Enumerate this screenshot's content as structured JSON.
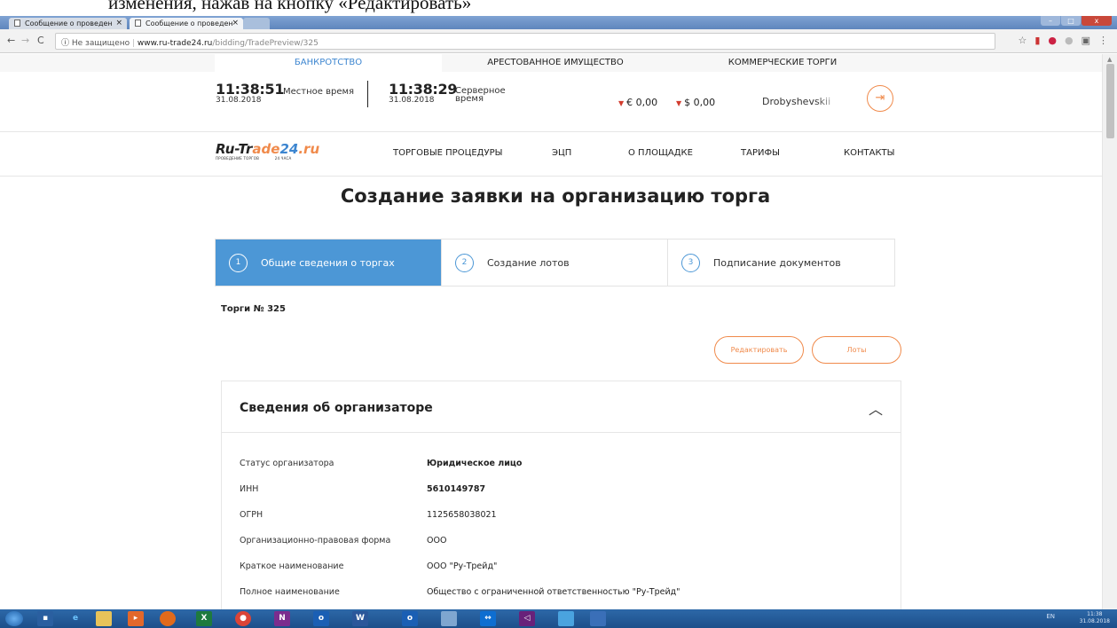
{
  "doc_caption": "изменения, нажав на кнопку «Редактировать»",
  "browser": {
    "tabs": [
      {
        "title": "Сообщение о проведен"
      },
      {
        "title": "Сообщение о проведен"
      }
    ],
    "close_glyph": "×",
    "address": {
      "security": "Не защищено",
      "host": "www.ru-trade24.ru",
      "path": "/bidding/TradePreview/325"
    },
    "nav_icons": [
      "back-icon",
      "forward-icon",
      "reload-icon"
    ],
    "toolbar_icons": [
      "star-icon",
      "extension-icon",
      "profile-icon",
      "circle-icon",
      "cast-icon",
      "menu-icon"
    ]
  },
  "top_nav": {
    "items": [
      "БАНКРОТСТВО",
      "АРЕСТОВАННОЕ ИМУЩЕСТВО",
      "КОММЕРЧЕСКИЕ ТОРГИ"
    ],
    "active_index": 0
  },
  "info": {
    "local": {
      "time": "11:38:51",
      "date": "31.08.2018",
      "label": "Местное время"
    },
    "server": {
      "time": "11:38:29",
      "date": "31.08.2018",
      "label_line1": "Серверное",
      "label_line2": "время"
    },
    "euro": "€ 0,00",
    "dollar": "$ 0,00",
    "user": "Drobyshevskii"
  },
  "logo": {
    "part1": "Ru-Tr",
    "part2": "ade",
    "part3": "24",
    "part4": ".ru",
    "sub_left": "ПРОВЕДЕНИЕ ТОРГОВ",
    "sub_right": "24 ЧАСА"
  },
  "main_nav": [
    "ТОРГОВЫЕ ПРОЦЕДУРЫ",
    "ЭЦП",
    "О ПЛОЩАДКЕ",
    "ТАРИФЫ",
    "КОНТАКТЫ"
  ],
  "page_title": "Создание заявки на организацию торга",
  "steps": [
    {
      "num": "1",
      "label": "Общие сведения о торгах",
      "active": true
    },
    {
      "num": "2",
      "label": "Создание лотов",
      "active": false
    },
    {
      "num": "3",
      "label": "Подписание документов",
      "active": false
    }
  ],
  "trade_number": "Торги № 325",
  "buttons": {
    "edit": "Редактировать",
    "lots": "Лоты"
  },
  "organizer": {
    "title": "Сведения об организаторе",
    "rows": [
      {
        "label": "Статус организатора",
        "value": "Юридическое лицо"
      },
      {
        "label": "ИНН",
        "value": "5610149787"
      },
      {
        "label": "ОГРН",
        "value": "1125658038021"
      },
      {
        "label": "Организационно-правовая форма",
        "value": "ООО"
      },
      {
        "label": "Краткое наименование",
        "value": "ООО \"Ру-Трейд\""
      },
      {
        "label": "Полное наименование",
        "value": "Общество с ограниченной ответственностью \"Ру-Трейд\""
      }
    ]
  },
  "taskbar": {
    "tray_lang": "EN",
    "clock_time": "11:38",
    "clock_date": "31.08.2018",
    "icons": [
      "start-orb",
      "save-icon",
      "ie-icon",
      "folder-icon",
      "media-icon",
      "firefox-icon",
      "excel-icon",
      "chrome-icon",
      "onenote-icon",
      "outlook-icon",
      "word-icon",
      "outlook-icon-2",
      "network-icon",
      "teamviewer-icon",
      "vs-icon",
      "pen-icon",
      "app-icon"
    ]
  },
  "colors": {
    "accent_blue": "#4c97d6",
    "accent_orange": "#f08a4b",
    "taskbar": "#1c4f8a"
  }
}
